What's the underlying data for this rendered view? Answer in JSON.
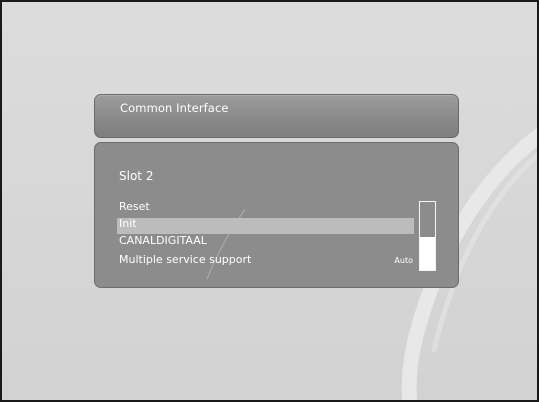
{
  "screen": {
    "dialog_title": "Common Interface"
  },
  "menu": {
    "slot_title": "Slot 2",
    "items": [
      {
        "label": "Reset",
        "value": ""
      },
      {
        "label": "Init",
        "value": ""
      },
      {
        "label": "CANALDIGITAAL",
        "value": ""
      },
      {
        "label": "Multiple service support",
        "value": "Auto"
      }
    ],
    "selected_index": 1
  },
  "scrollbar": {
    "thumb_start_fraction": 0.52,
    "thumb_end_fraction": 1.0
  },
  "colors": {
    "panel": "#8c8c8c",
    "highlight": "#bcbcbc",
    "text": "#ffffff"
  }
}
